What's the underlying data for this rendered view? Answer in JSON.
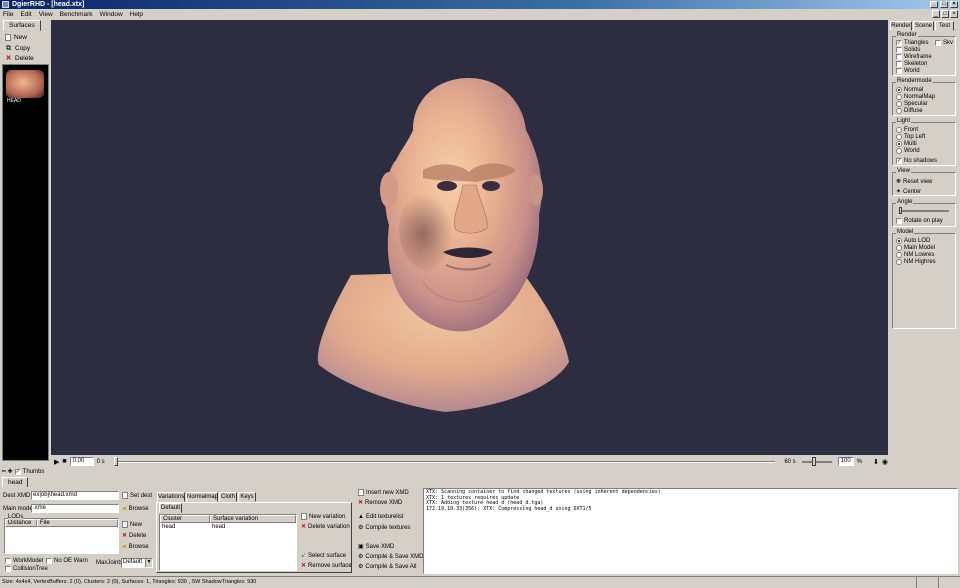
{
  "window": {
    "title": "DgierRHD - [head.xtx]",
    "min": "_",
    "max": "□",
    "close": "×"
  },
  "menu": [
    "File",
    "Edit",
    "View",
    "Benchmark",
    "Window",
    "Help"
  ],
  "mdi_controls": [
    "_",
    "□",
    "×"
  ],
  "left_panel": {
    "tab": "Surfaces",
    "buttons": [
      {
        "label": "New",
        "icon": "new-doc-icon"
      },
      {
        "label": "Copy",
        "icon": "copy-icon"
      },
      {
        "label": "Delete",
        "icon": "delete-x-icon"
      }
    ],
    "thumbnail_label": "HEAD"
  },
  "timeline": {
    "frame": "0.00",
    "start": "0 s",
    "end": "60 s",
    "zoom": "100",
    "zoom_unit": "%"
  },
  "right_panel": {
    "tabs": [
      "Render",
      "Scene",
      "Test"
    ],
    "render_group": {
      "title": "Render",
      "options": [
        {
          "label": "Triangles",
          "checked": true
        },
        {
          "label": "Solids",
          "checked": false
        },
        {
          "label": "Wireframe",
          "checked": false
        },
        {
          "label": "Skeleton",
          "checked": false
        },
        {
          "label": "World",
          "checked": false
        }
      ],
      "extra": {
        "label": "Skv",
        "checked": false
      }
    },
    "rendermode_group": {
      "title": "Rendermode",
      "options": [
        {
          "label": "Normal",
          "selected": true
        },
        {
          "label": "NormalMap",
          "selected": false
        },
        {
          "label": "Specular",
          "selected": false
        },
        {
          "label": "Diffuse",
          "selected": false
        }
      ]
    },
    "light_group": {
      "title": "Light",
      "options": [
        {
          "label": "Front",
          "selected": false
        },
        {
          "label": "Top Left",
          "selected": false
        },
        {
          "label": "Multi",
          "selected": true
        },
        {
          "label": "World",
          "selected": false
        }
      ],
      "shadows": {
        "label": "No shadows",
        "checked": true
      }
    },
    "view_group": {
      "title": "View",
      "reset": "Reset view",
      "center": "Center"
    },
    "angle_group": {
      "title": "Angle",
      "rotate": {
        "label": "Rotate on play",
        "checked": false
      }
    },
    "model_group": {
      "title": "Model",
      "options": [
        {
          "label": "Auto LOD",
          "selected": true
        },
        {
          "label": "Main Model",
          "selected": false
        },
        {
          "label": "NM Lowres",
          "selected": false
        },
        {
          "label": "NM Highres",
          "selected": false
        }
      ]
    }
  },
  "thumbs_bar": {
    "label": "Thumbs",
    "checked": true
  },
  "bottom_tab": "head",
  "bottom": {
    "dest_xmd_label": "Dest XMD",
    "dest_xmd_value": "ex|obj\\head.xmd",
    "set_dest": "Set dest",
    "main_model_label": "Main model",
    "main_model_value": ".xme",
    "browse": "Browse",
    "lods_label": "LODs",
    "lod_cols": [
      "Distance",
      "File"
    ],
    "lod_buttons": [
      "New",
      "Delete",
      "Browse"
    ],
    "workmodel": {
      "label": "WorkModel",
      "checked": false
    },
    "no_oe_warn": {
      "label": "No OE Warn",
      "checked": false
    },
    "collision_tree": {
      "label": "CollisionTree",
      "checked": false
    },
    "maxjoints_label": "MaxJoints",
    "maxjoints_value": "Default",
    "var_tabs": [
      "Variations",
      "Normalmap",
      "Cloth",
      "Keys"
    ],
    "default_tab": "Default",
    "var_cols": [
      "Cluster",
      "Surface variation"
    ],
    "var_rows": [
      {
        "cluster": "head",
        "variation": "head"
      }
    ],
    "var_buttons": [
      "New variation",
      "Delete variation",
      "Select surface",
      "Remove surface"
    ],
    "actions": [
      "Insert new XMD",
      "Remove XMD",
      "Edit texturelist",
      "Compile textures",
      "Save XMD",
      "Compile & Save XMD",
      "Compile & Save All"
    ],
    "log": [
      "XTX: Scanning container to find changed textures (using inherent dependencies)",
      "XTX: 1 textures requires update",
      "XTX: Adding texture head_d (head_d.tga)",
      "172.19.10.33(356): XTX: Compressing head_d using DXT1/5"
    ]
  },
  "status": "Size: 4x4x4, VertexBuffers: 2 (0), Clusters: 2 (0), Surfaces: 1, Triangles: 930 , SW ShadowTriangles: 930"
}
